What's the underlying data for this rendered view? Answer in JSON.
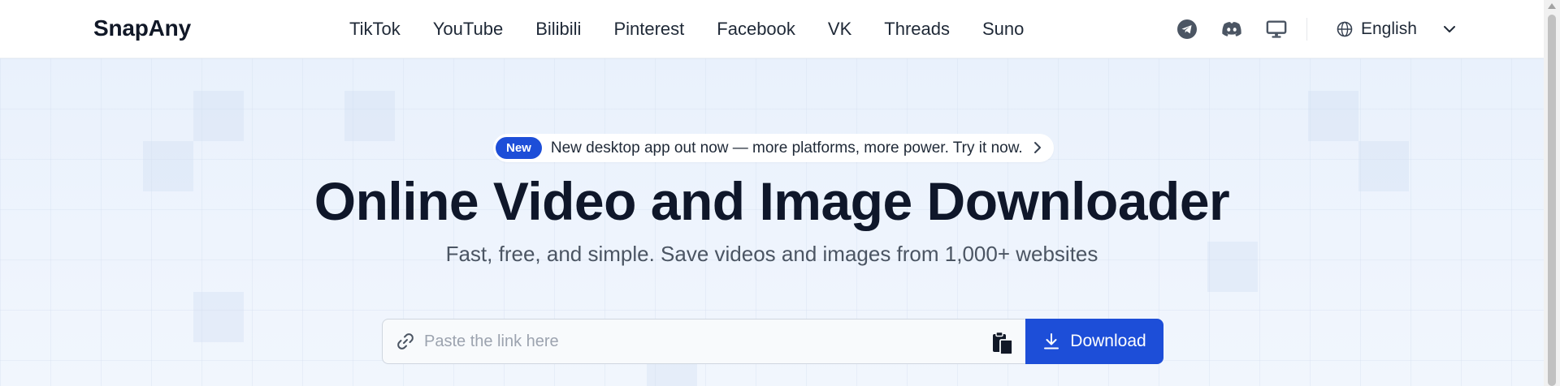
{
  "brand": {
    "logo": "SnapAny"
  },
  "nav": {
    "items": [
      "TikTok",
      "YouTube",
      "Bilibili",
      "Pinterest",
      "Facebook",
      "VK",
      "Threads",
      "Suno"
    ]
  },
  "header_icons": [
    "telegram-icon",
    "discord-icon",
    "desktop-icon"
  ],
  "language": {
    "selected": "English",
    "icon": "globe-icon"
  },
  "announcement": {
    "badge": "New",
    "text": "New desktop app out now — more platforms, more power. Try it now."
  },
  "hero": {
    "title": "Online Video and Image Downloader",
    "subtitle": "Fast, free, and simple. Save videos and images from 1,000+ websites"
  },
  "search": {
    "placeholder": "Paste the link here",
    "value": "",
    "button_label": "Download"
  },
  "colors": {
    "accent": "#1d4ed8",
    "hero_bg": "#eaf2fd",
    "text_dark": "#0f172a",
    "text_muted": "#4b5563"
  }
}
